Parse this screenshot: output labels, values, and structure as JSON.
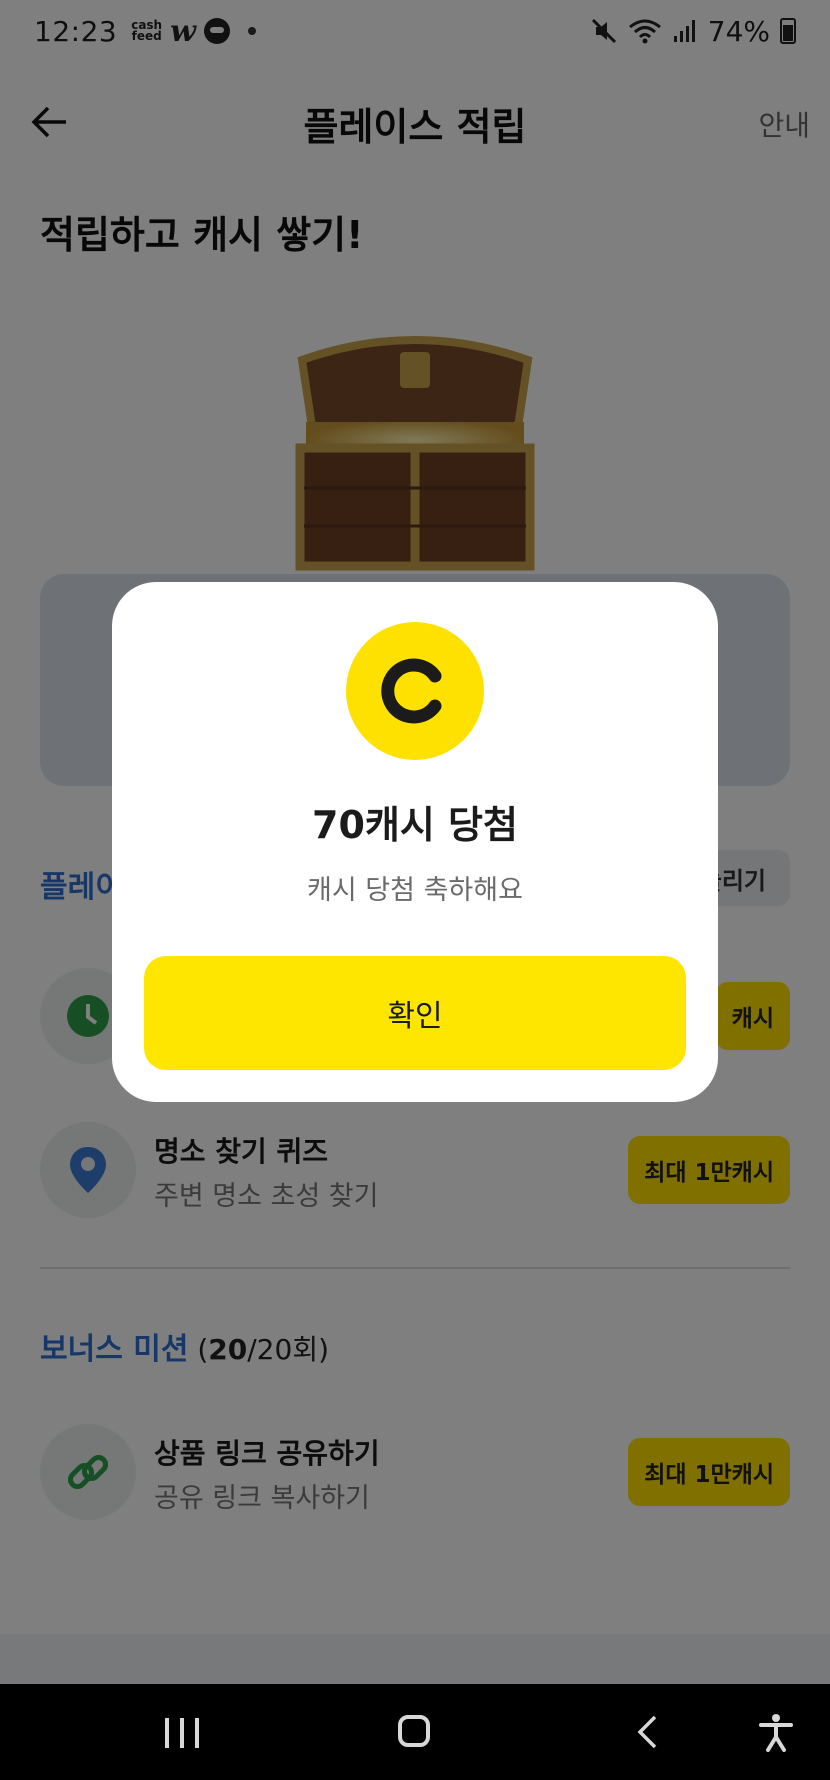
{
  "status_bar": {
    "time": "12:23",
    "app_badge_1": "cash\nfeed",
    "app_badge_2": "w",
    "battery": "74%"
  },
  "header": {
    "title": "플레이스 적립",
    "guide_label": "안내"
  },
  "headline": "적립하고 캐시 쌓기!",
  "place_section": {
    "title": "플레이",
    "action_label": "늘리기"
  },
  "missions": [
    {
      "title": "",
      "subtitle": "",
      "reward": "캐시",
      "icon": "clock-icon"
    },
    {
      "title": "명소 찾기 퀴즈",
      "subtitle": "주변 명소 초성 찾기",
      "reward": "최대 1만캐시",
      "icon": "location-pin-icon"
    }
  ],
  "bonus": {
    "title": "보너스 미션",
    "count_open": " (",
    "count_done": "20",
    "count_rest": "/20회)",
    "mission": {
      "title": "상품 링크 공유하기",
      "subtitle": "공유 링크 복사하기",
      "reward": "최대 1만캐시",
      "icon": "link-icon"
    }
  },
  "dialog": {
    "coin_letter": "C",
    "title": "70캐시 당첨",
    "subtitle": "캐시 당첨 축하해요",
    "confirm_label": "확인"
  },
  "colors": {
    "accent_yellow": "#ffe100",
    "section_blue": "#2f6fd3",
    "overlay": "rgba(0,0,0,0.5)"
  }
}
